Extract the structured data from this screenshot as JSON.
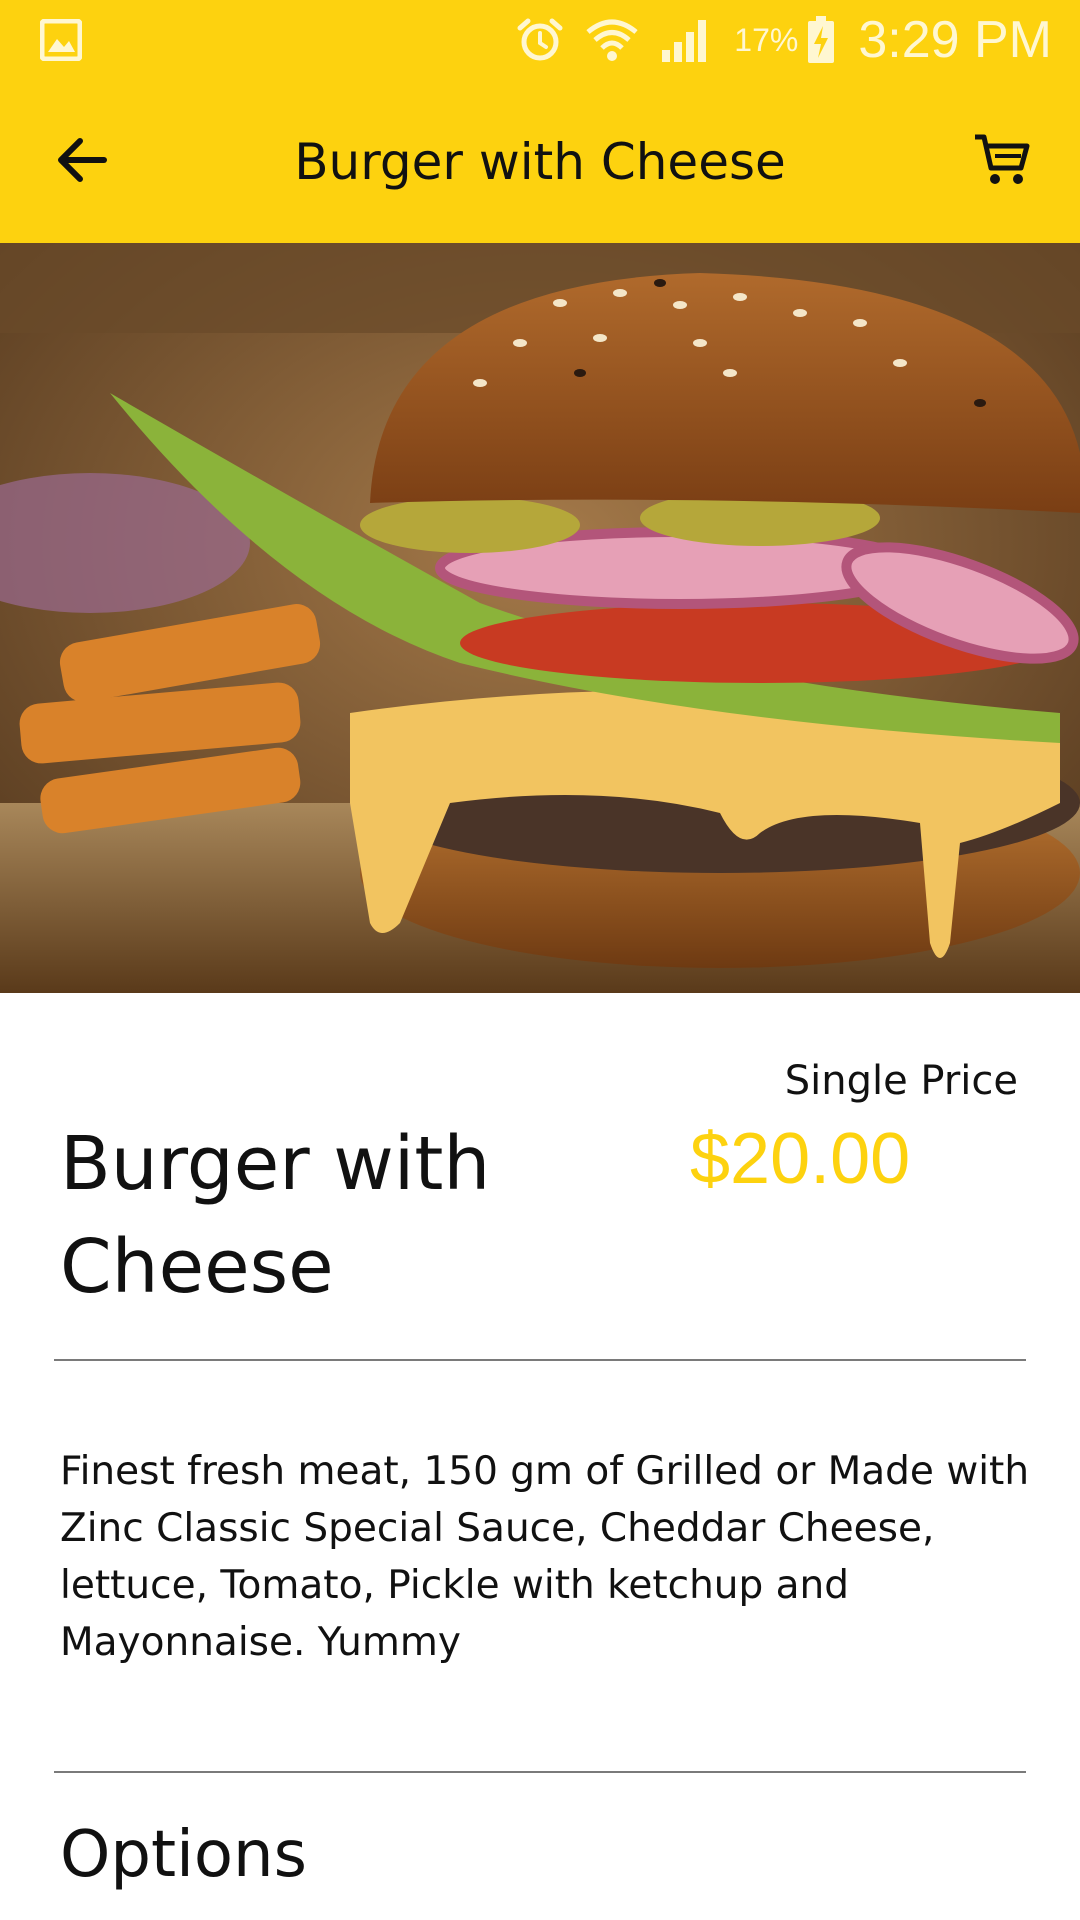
{
  "status_bar": {
    "battery_percent": "17%",
    "time": "3:29 PM",
    "icons": [
      "gallery-notification-icon",
      "alarm-icon",
      "wifi-icon",
      "signal-icon",
      "battery-charging-icon"
    ]
  },
  "app_bar": {
    "title": "Burger with Cheese",
    "back_icon": "arrow-left-icon",
    "cart_icon": "cart-icon",
    "background": "#fdd20f"
  },
  "hero": {
    "image": "burger-photo"
  },
  "product": {
    "name": "Burger with Cheese",
    "price_label": "Single Price",
    "price": "$20.00",
    "price_color": "#fdd20f",
    "description": "Finest fresh meat, 150 gm of Grilled or Made with Zinc Classic Special Sauce, Cheddar Cheese, lettuce, Tomato, Pickle with ketchup and Mayonnaise. Yummy"
  },
  "options": {
    "title": "Options"
  }
}
